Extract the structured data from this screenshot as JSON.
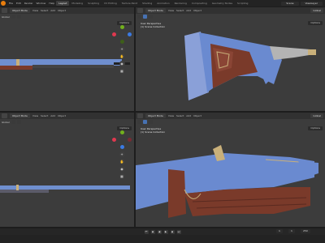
{
  "topbar": {
    "menus": [
      "File",
      "Edit",
      "Render",
      "Window",
      "Help"
    ],
    "workspaces": [
      "Layout",
      "Modeling",
      "Sculpting",
      "UV Editing",
      "Texture Paint",
      "Shading",
      "Animation",
      "Rendering",
      "Compositing",
      "Geometry Nodes",
      "Scripting"
    ],
    "active_workspace": "Layout",
    "scene_label": "Scene",
    "view_layer_label": "ViewLayer"
  },
  "viewport_tl": {
    "mode": "Object Mode",
    "menus": [
      "View",
      "Select",
      "Add",
      "Object"
    ],
    "transform": "Global",
    "options": "Options"
  },
  "viewport_tr": {
    "mode": "Object Mode",
    "menus": [
      "View",
      "Select",
      "Add",
      "Object"
    ],
    "transform": "Global",
    "options": "Options",
    "perspective": "User Perspective",
    "collection": "(1) Scene Collection"
  },
  "viewport_bl": {
    "mode": "Object Mode",
    "menus": [
      "View",
      "Select",
      "Add",
      "Object"
    ],
    "transform": "Global",
    "options": "Options"
  },
  "viewport_br": {
    "mode": "Object Mode",
    "menus": [
      "View",
      "Select",
      "Add",
      "Object"
    ],
    "transform": "Global",
    "options": "Options",
    "perspective": "User Perspective",
    "collection": "(1) Scene Collection"
  },
  "timeline": {
    "current_frame": "1",
    "start": "1",
    "end": "250"
  },
  "colors": {
    "accent": "#e87d0d",
    "active_blue": "#4772b3",
    "barrel_blue": "#7d9bd6",
    "wood_brown": "#7a3a2a",
    "brass": "#c9b07a"
  }
}
